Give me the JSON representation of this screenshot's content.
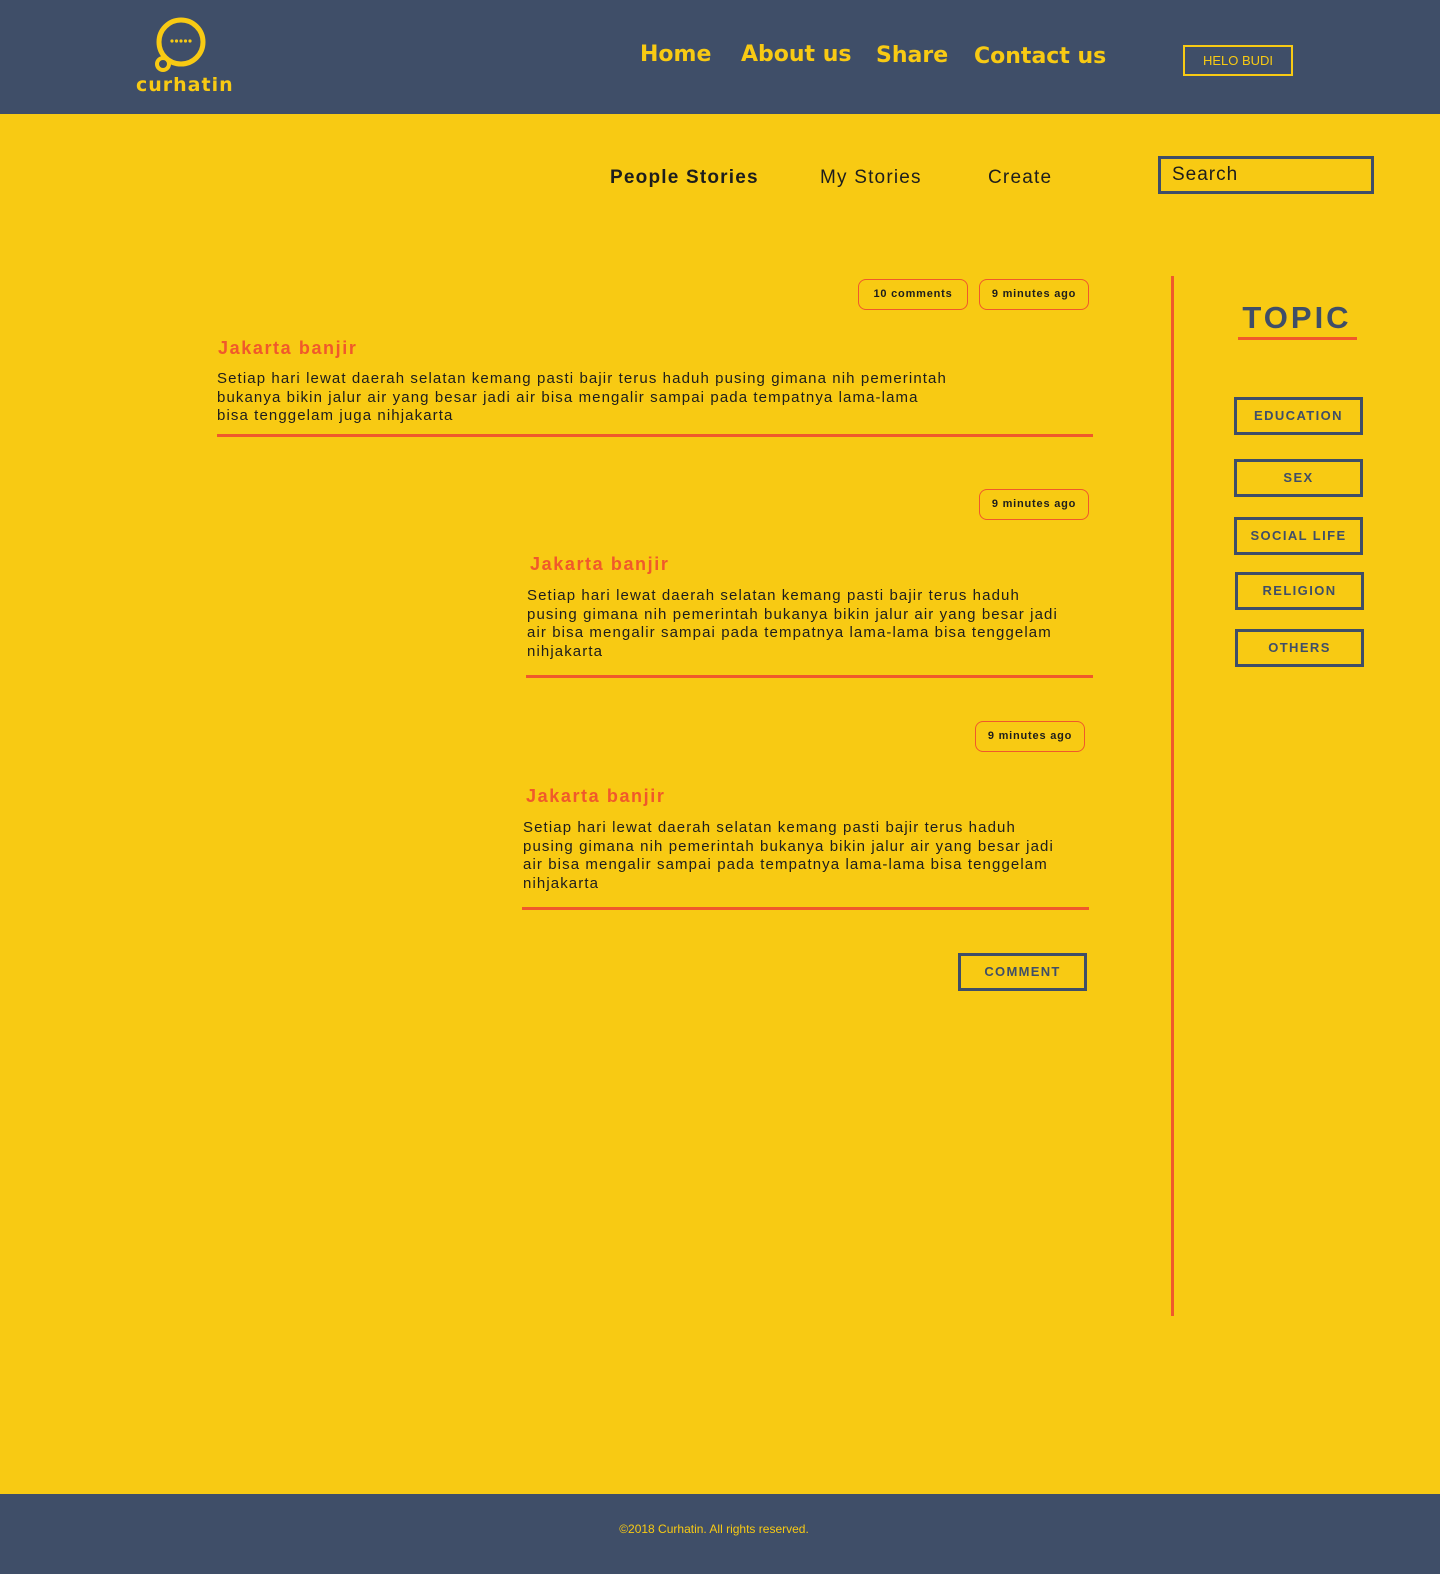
{
  "brand": {
    "name": "curhatin",
    "logo_icon": "speech-bubble-icon",
    "colors": {
      "primary": "#3f4e68",
      "accent": "#f8ca13",
      "highlight": "#f0592b"
    }
  },
  "nav": {
    "home": "Home",
    "about": "About us",
    "share": "Share",
    "contact": "Contact us"
  },
  "user": {
    "greeting": "HELO BUDI"
  },
  "tabs": {
    "people": "People Stories",
    "my": "My Stories",
    "create": "Create"
  },
  "search": {
    "placeholder": "Search"
  },
  "stories": [
    {
      "comments": "10 comments",
      "time": "9 minutes ago",
      "title": "Jakarta banjir",
      "body_lines": [
        "Setiap hari lewat daerah selatan kemang pasti bajir terus haduh pusing gimana nih pemerintah",
        "bukanya bikin jalur air yang besar jadi air bisa mengalir sampai pada tempatnya lama-lama",
        "bisa tenggelam juga nihjakarta"
      ]
    },
    {
      "time": "9 minutes ago",
      "title": "Jakarta banjir",
      "body_lines": [
        "Setiap hari lewat daerah selatan kemang pasti bajir terus haduh",
        "pusing gimana nih pemerintah bukanya bikin jalur air yang besar jadi",
        "air bisa mengalir sampai pada tempatnya lama-lama bisa tenggelam",
        "nihjakarta"
      ]
    },
    {
      "time": "9 minutes ago",
      "title": "Jakarta banjir",
      "body_lines": [
        "Setiap hari lewat daerah selatan kemang pasti bajir terus haduh",
        "pusing gimana nih pemerintah bukanya bikin jalur air yang besar jadi",
        "air bisa mengalir sampai pada tempatnya lama-lama bisa tenggelam",
        "nihjakarta"
      ]
    }
  ],
  "comment_button": "COMMENT",
  "topic": {
    "title": "TOPIC",
    "items": [
      "EDUCATION",
      "SEX",
      "SOCIAL LIFE",
      "RELIGION",
      "OTHERS"
    ]
  },
  "footer": {
    "text": "©2018 Curhatin. All rights reserved."
  }
}
